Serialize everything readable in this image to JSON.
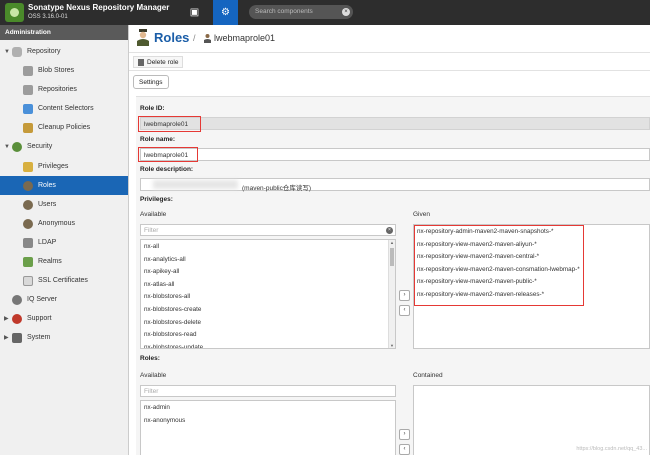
{
  "header": {
    "app_title": "Sonatype Nexus Repository Manager",
    "version": "OSS 3.16.0-01",
    "search_placeholder": "Search components"
  },
  "sidebar": {
    "heading": "Administration",
    "items": [
      {
        "label": "Repository",
        "icon": "database-icon"
      },
      {
        "label": "Blob Stores",
        "icon": "blob-store-icon"
      },
      {
        "label": "Repositories",
        "icon": "repositories-icon"
      },
      {
        "label": "Content Selectors",
        "icon": "content-selector-icon"
      },
      {
        "label": "Cleanup Policies",
        "icon": "cleanup-brush-icon"
      },
      {
        "label": "Security",
        "icon": "security-badge-icon"
      },
      {
        "label": "Privileges",
        "icon": "key-icon"
      },
      {
        "label": "Roles",
        "icon": "role-user-icon"
      },
      {
        "label": "Users",
        "icon": "users-icon"
      },
      {
        "label": "Anonymous",
        "icon": "anonymous-icon"
      },
      {
        "label": "LDAP",
        "icon": "ldap-icon"
      },
      {
        "label": "Realms",
        "icon": "realms-icon"
      },
      {
        "label": "SSL Certificates",
        "icon": "certificate-icon"
      },
      {
        "label": "IQ Server",
        "icon": "iq-server-icon"
      },
      {
        "label": "Support",
        "icon": "support-icon"
      },
      {
        "label": "System",
        "icon": "system-icon"
      }
    ]
  },
  "page": {
    "title": "Roles",
    "breadcrumb_sep": "/",
    "breadcrumb_name": "lwebmaprole01",
    "delete_label": "Delete role",
    "settings_tab": "Settings"
  },
  "form": {
    "role_id_label": "Role ID:",
    "role_id_value": "lwebmaprole01",
    "role_name_label": "Role name:",
    "role_name_value": "lwebmaprole01",
    "role_description_label": "Role description:",
    "role_description_value": "(maven-public仓库读写)",
    "privileges_label": "Privileges:",
    "available_label": "Available",
    "given_label": "Given",
    "filter_placeholder": "Filter",
    "available_privileges": [
      "nx-all",
      "nx-analytics-all",
      "nx-apikey-all",
      "nx-atlas-all",
      "nx-blobstores-all",
      "nx-blobstores-create",
      "nx-blobstores-delete",
      "nx-blobstores-read",
      "nx-blobstores-update"
    ],
    "given_privileges": [
      "nx-repository-admin-maven2-maven-snapshots-*",
      "nx-repository-view-maven2-maven-aliyun-*",
      "nx-repository-view-maven2-maven-central-*",
      "nx-repository-view-maven2-maven-consmation-lwebmap-*",
      "nx-repository-view-maven2-maven-public-*",
      "nx-repository-view-maven2-maven-releases-*"
    ],
    "roles_label": "Roles:",
    "roles_available_label": "Available",
    "contained_label": "Contained",
    "available_roles": [
      "nx-admin",
      "nx-anonymous"
    ],
    "move_right": "›",
    "move_left": "‹"
  },
  "watermark": "https://blog.csdn.net/qq_43..."
}
